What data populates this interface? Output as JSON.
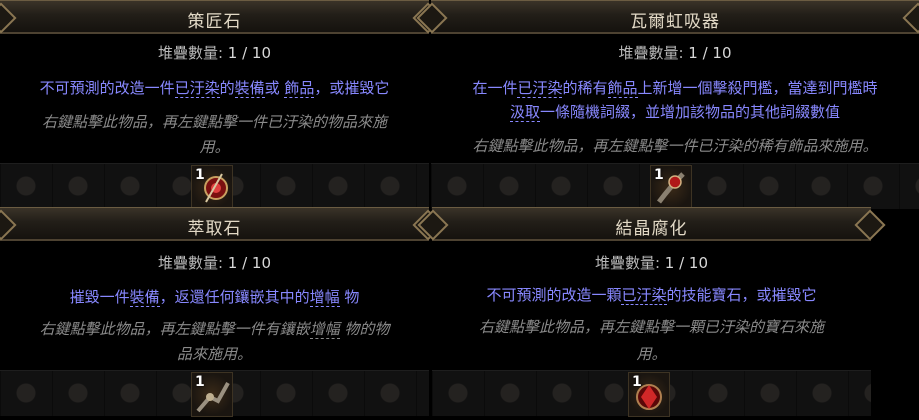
{
  "panels": [
    {
      "title": "策匠石",
      "stack_label": "堆疊數量:",
      "stack_value": "1 / 10",
      "mod_parts": [
        "不可預測的改造一件",
        "已汙染",
        "的",
        "裝備",
        "或 ",
        "飾品",
        "，或摧毀它"
      ],
      "help_lines": [
        "右鍵點擊此物品，再左鍵點擊一件已汙染的物品來施",
        "用。"
      ],
      "slot_count": "1"
    },
    {
      "title": "瓦爾虹吸器",
      "stack_label": "堆疊數量:",
      "stack_value": "1 / 10",
      "mod_line1_parts": [
        "在一件",
        "已汙染",
        "的稀有",
        "飾品",
        "上新增一個擊殺門檻，當達到門檻時"
      ],
      "mod_line2_parts": [
        "汲取",
        "一條隨機詞綴，並增加該物品的其他詞綴數值"
      ],
      "help_lines": [
        "右鍵點擊此物品，再左鍵點擊一件已汙染的稀有飾品來施用。"
      ],
      "slot_count": "1"
    },
    {
      "title": "萃取石",
      "stack_label": "堆疊數量:",
      "stack_value": "1 / 10",
      "mod_parts": [
        "摧毀一件",
        "裝備",
        "，返還任何鑲嵌其中的",
        "增幅",
        " 物"
      ],
      "help_line1_parts": [
        "右鍵點擊此物品，再左鍵點擊一件有鑲嵌",
        "增幅",
        " 物的物"
      ],
      "help_line2": "品來施用。",
      "slot_count": "1"
    },
    {
      "title": "結晶腐化",
      "stack_label": "堆疊數量:",
      "stack_value": "1 / 10",
      "mod_parts": [
        "不可預測的改造一顆",
        "已汙染",
        "的技能寶石，或摧毀它"
      ],
      "help_lines": [
        "右鍵點擊此物品，再左鍵點擊一顆已汙染的寶石來施",
        "用。"
      ],
      "slot_count": "1"
    }
  ],
  "colors": {
    "title": "#e2d9c6",
    "mod": "#8888ff",
    "help": "#8a8a8a",
    "stack": "#d8d8d8"
  },
  "icons": [
    "orb-crafting-icon",
    "vaal-siphon-icon",
    "extraction-stone-icon",
    "crystal-corruption-icon"
  ]
}
